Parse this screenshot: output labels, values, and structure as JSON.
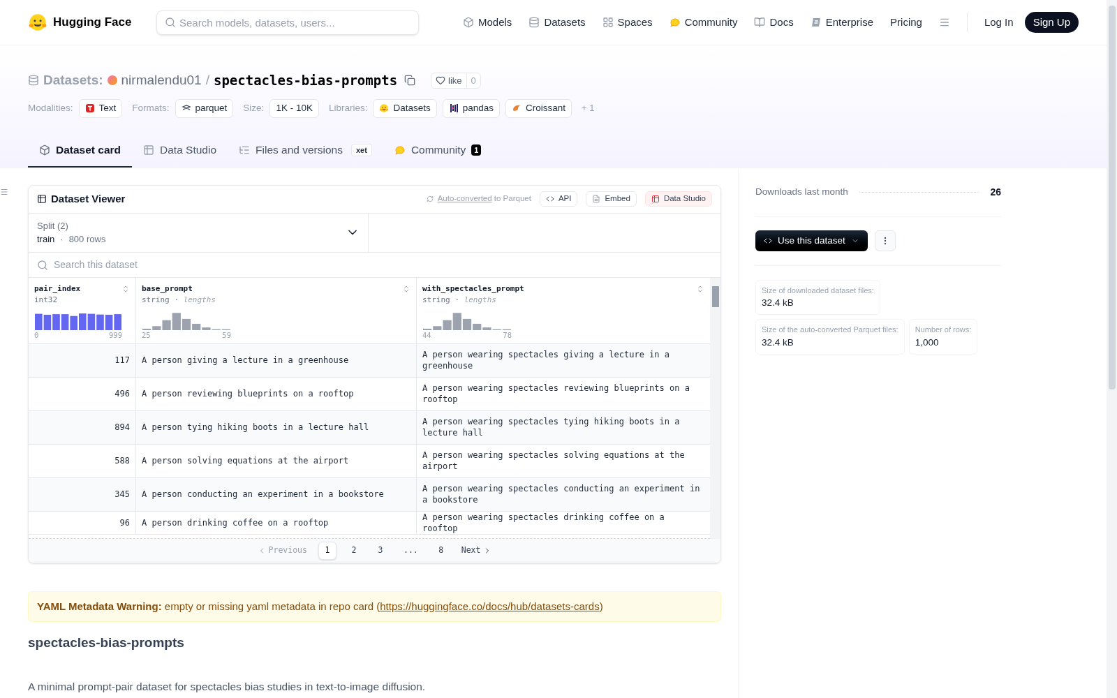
{
  "header": {
    "brand": "Hugging Face",
    "search": {
      "placeholder": "Search models, datasets, users..."
    },
    "nav": [
      {
        "label": "Models",
        "kind": "models"
      },
      {
        "label": "Datasets",
        "kind": "datasets"
      },
      {
        "label": "Spaces",
        "kind": "spaces"
      },
      {
        "label": "Community",
        "kind": "community"
      },
      {
        "label": "Docs",
        "kind": "docs"
      },
      {
        "label": "Enterprise",
        "kind": "enterprise"
      },
      {
        "label": "Pricing",
        "kind": "plain"
      }
    ],
    "login": "Log In",
    "signup": "Sign Up"
  },
  "repo": {
    "type_label": "Datasets:",
    "owner": "nirmalendu01",
    "separator": "/",
    "name": "spectacles-bias-prompts",
    "like_label": "like",
    "like_count": "0"
  },
  "tags": [
    {
      "heading": "Modalities:",
      "items": [
        {
          "label": "Text",
          "kind": "text"
        }
      ]
    },
    {
      "heading": "Formats:",
      "items": [
        {
          "label": "parquet",
          "kind": "parquet"
        }
      ]
    },
    {
      "heading": "Size:",
      "items": [
        {
          "label": "1K - 10K",
          "kind": "plain"
        }
      ]
    },
    {
      "heading": "Libraries:",
      "items": [
        {
          "label": "Datasets",
          "kind": "hf"
        },
        {
          "label": "pandas",
          "kind": "pandas"
        },
        {
          "label": "Croissant",
          "kind": "croissant"
        }
      ]
    }
  ],
  "tags_more": "+ 1",
  "tabs": [
    {
      "label": "Dataset card",
      "kind": "card",
      "selected": true
    },
    {
      "label": "Data Studio",
      "kind": "studio",
      "selected": false
    },
    {
      "label": "Files and versions",
      "kind": "files",
      "badge": "xet",
      "selected": false
    },
    {
      "label": "Community",
      "kind": "community",
      "count": "1",
      "selected": false
    }
  ],
  "viewer": {
    "title": "Dataset Viewer",
    "auto_link": "Auto-converted",
    "auto_rest": "to Parquet",
    "buttons": [
      {
        "label": "API",
        "kind": "api"
      },
      {
        "label": "Embed",
        "kind": "embed"
      },
      {
        "label": "Data Studio",
        "kind": "studio"
      }
    ],
    "split_label": "Split (2)",
    "split_value": "train",
    "split_dot": "·",
    "split_rows": "800 rows",
    "search": {
      "placeholder": "Search this dataset"
    },
    "columns": [
      {
        "name": "pair_index",
        "type": "int32",
        "kind": "int",
        "min": "0",
        "max": "999"
      },
      {
        "name": "base_prompt",
        "type": "string",
        "type_dot": "·",
        "type_note": "lengths",
        "kind": "string",
        "min": "25",
        "max": "59"
      },
      {
        "name": "with_spectacles_prompt",
        "type": "string",
        "type_dot": "·",
        "type_note": "lengths",
        "kind": "string",
        "min": "44",
        "max": "78"
      }
    ],
    "rows": [
      [
        "117",
        "A person giving a lecture in a greenhouse",
        "A person wearing spectacles giving a lecture in a greenhouse"
      ],
      [
        "496",
        "A person reviewing blueprints on a rooftop",
        "A person wearing spectacles reviewing blueprints on a rooftop"
      ],
      [
        "894",
        "A person tying hiking boots in a lecture hall",
        "A person wearing spectacles tying hiking boots in a lecture hall"
      ],
      [
        "588",
        "A person solving equations at the airport",
        "A person wearing spectacles solving equations at the airport"
      ],
      [
        "345",
        "A person conducting an experiment in a bookstore",
        "A person wearing spectacles conducting an experiment in a bookstore"
      ],
      [
        "96",
        "A person drinking coffee on a rooftop",
        "A person wearing spectacles drinking coffee on a rooftop"
      ]
    ],
    "pagination": {
      "previous": "Previous",
      "next": "Next",
      "pages": [
        {
          "label": "1",
          "selected": true
        },
        {
          "label": "2",
          "selected": false
        },
        {
          "label": "3",
          "selected": false
        },
        {
          "label": "...",
          "selected": false
        },
        {
          "label": "8",
          "selected": false
        }
      ]
    }
  },
  "warning": {
    "label": "YAML Metadata Warning:",
    "text": "empty or missing yaml metadata in repo card (",
    "link": "https://huggingface.co/docs/hub/datasets-cards",
    "end": ")"
  },
  "card": {
    "heading": "spectacles-bias-prompts",
    "description": "A minimal prompt-pair dataset for spectacles bias studies in text-to-image diffusion."
  },
  "sidebar": {
    "downloads_label": "Downloads last month",
    "downloads": "26",
    "use_button": "Use this dataset",
    "stats": [
      {
        "label": "Size of downloaded dataset files:",
        "value": "32.4 kB"
      },
      {
        "label": "Size of the auto-converted Parquet files:",
        "value": "32.4 kB"
      },
      {
        "label": "Number of rows:",
        "value": "1,000"
      }
    ]
  }
}
